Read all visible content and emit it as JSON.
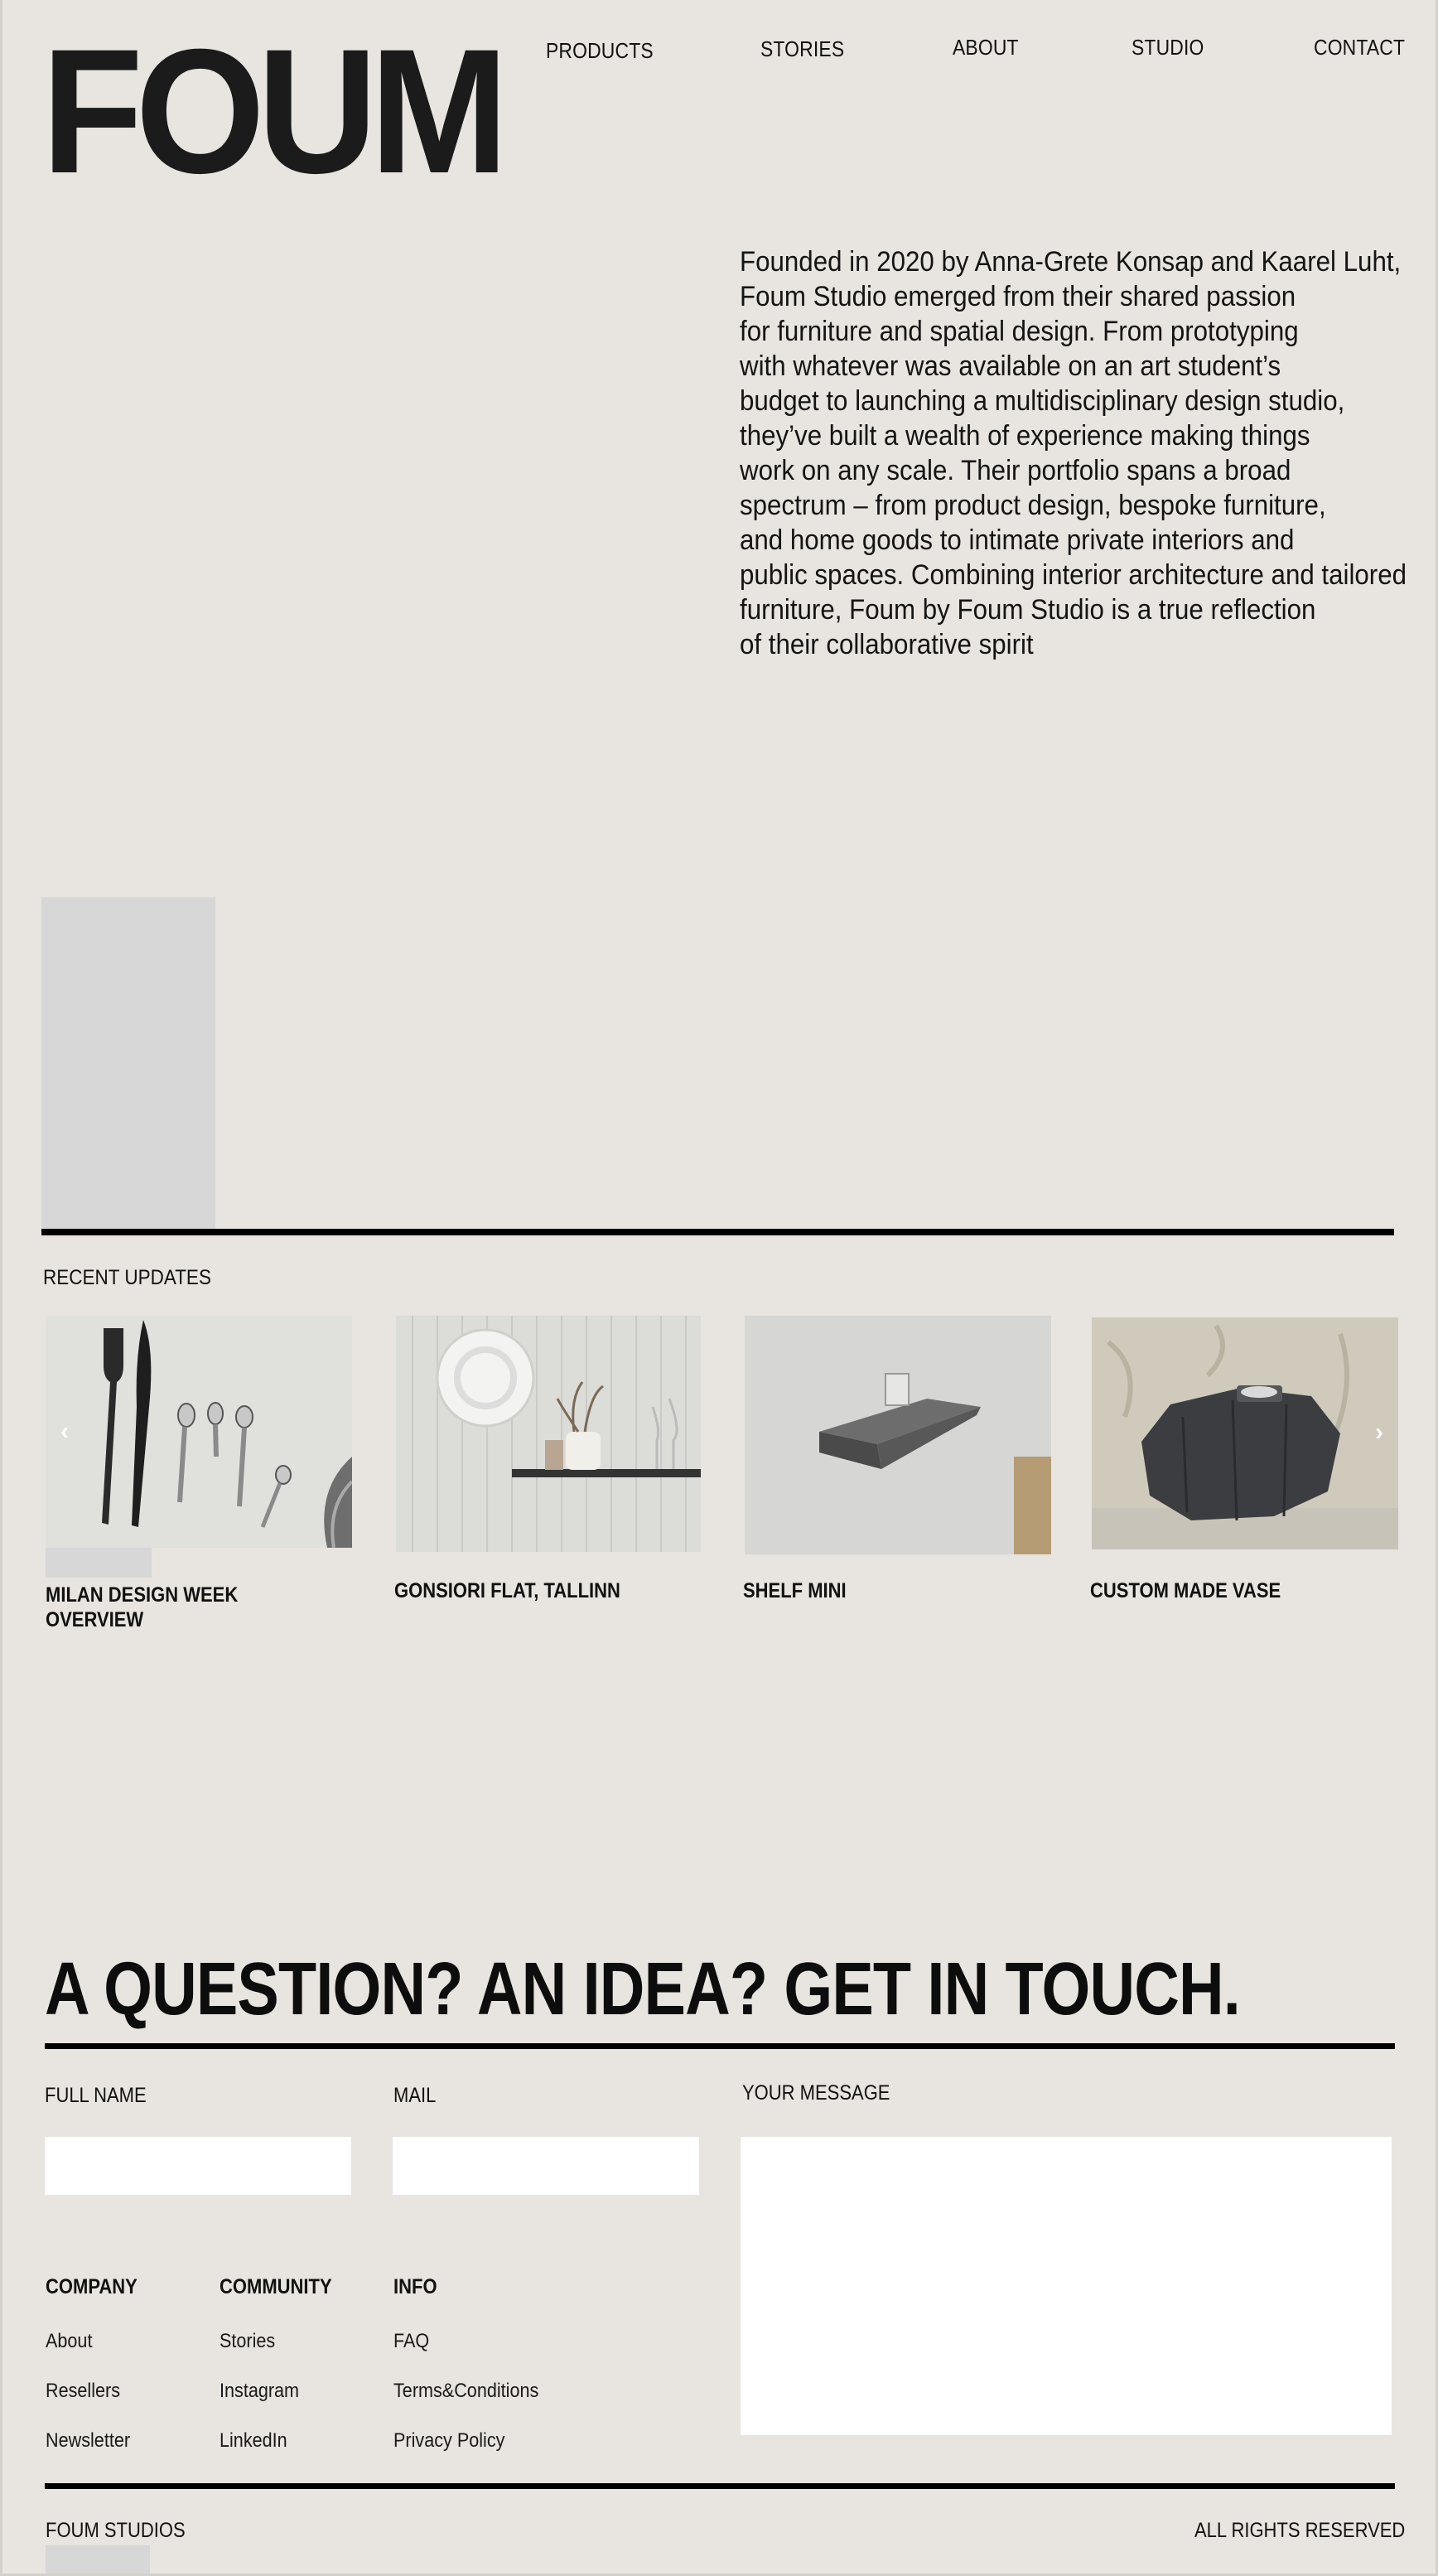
{
  "header": {
    "logo": "FOUM",
    "nav": [
      {
        "label": "PRODUCTS"
      },
      {
        "label": "STORIES"
      },
      {
        "label": "ABOUT"
      },
      {
        "label": "STUDIO"
      },
      {
        "label": "CONTACT"
      }
    ]
  },
  "intro": {
    "lines": [
      "Founded in 2020 by Anna-Grete Konsap and Kaarel Luht,",
      "Foum Studio emerged from their shared passion",
      "for furniture and spatial design. From prototyping",
      "with whatever was available on an art student’s",
      "budget to launching a multidisciplinary design studio,",
      "they’ve built a wealth of experience making things",
      "work on any scale. Their portfolio spans a broad",
      "spectrum – from product design, bespoke furniture,",
      "and home goods to intimate private interiors and",
      "public spaces. Combining interior architecture and tailored",
      "furniture, Foum by Foum Studio is a true reflection",
      "of their collaborative spirit"
    ]
  },
  "recent": {
    "label": "RECENT UPDATES",
    "cards": [
      {
        "title_line1": "MILAN DESIGN WEEK",
        "title_line2": "OVERVIEW",
        "image": "cutlery-photo"
      },
      {
        "title_line1": "GONSIORI FLAT, TALLINN",
        "image": "shelf-interior-photo"
      },
      {
        "title_line1": "SHELF MINI",
        "image": "metal-shelf-photo"
      },
      {
        "title_line1": "CUSTOM MADE VASE",
        "image": "stone-vase-photo"
      }
    ],
    "prev_icon": "chevron-left-icon",
    "next_icon": "chevron-right-icon"
  },
  "contact": {
    "heading": "A QUESTION? AN IDEA? GET IN TOUCH.",
    "full_name_label": "FULL NAME",
    "mail_label": "MAIL",
    "message_label": "YOUR MESSAGE",
    "full_name_value": "",
    "mail_value": "",
    "message_value": ""
  },
  "footer": {
    "columns": [
      {
        "heading": "COMPANY",
        "links": [
          "About",
          "Resellers",
          "Newsletter"
        ]
      },
      {
        "heading": "COMMUNITY",
        "links": [
          "Stories",
          "Instagram",
          "LinkedIn"
        ]
      },
      {
        "heading": "INFO",
        "links": [
          "FAQ",
          "Terms&Conditions",
          "Privacy Policy"
        ]
      }
    ],
    "left": "FOUM STUDIOS",
    "right": "ALL RIGHTS RESERVED"
  },
  "colors": {
    "background": "#e8e4df",
    "text": "#111111",
    "rule": "#000000",
    "placeholder": "#d7d7d7",
    "input": "#ffffff"
  }
}
